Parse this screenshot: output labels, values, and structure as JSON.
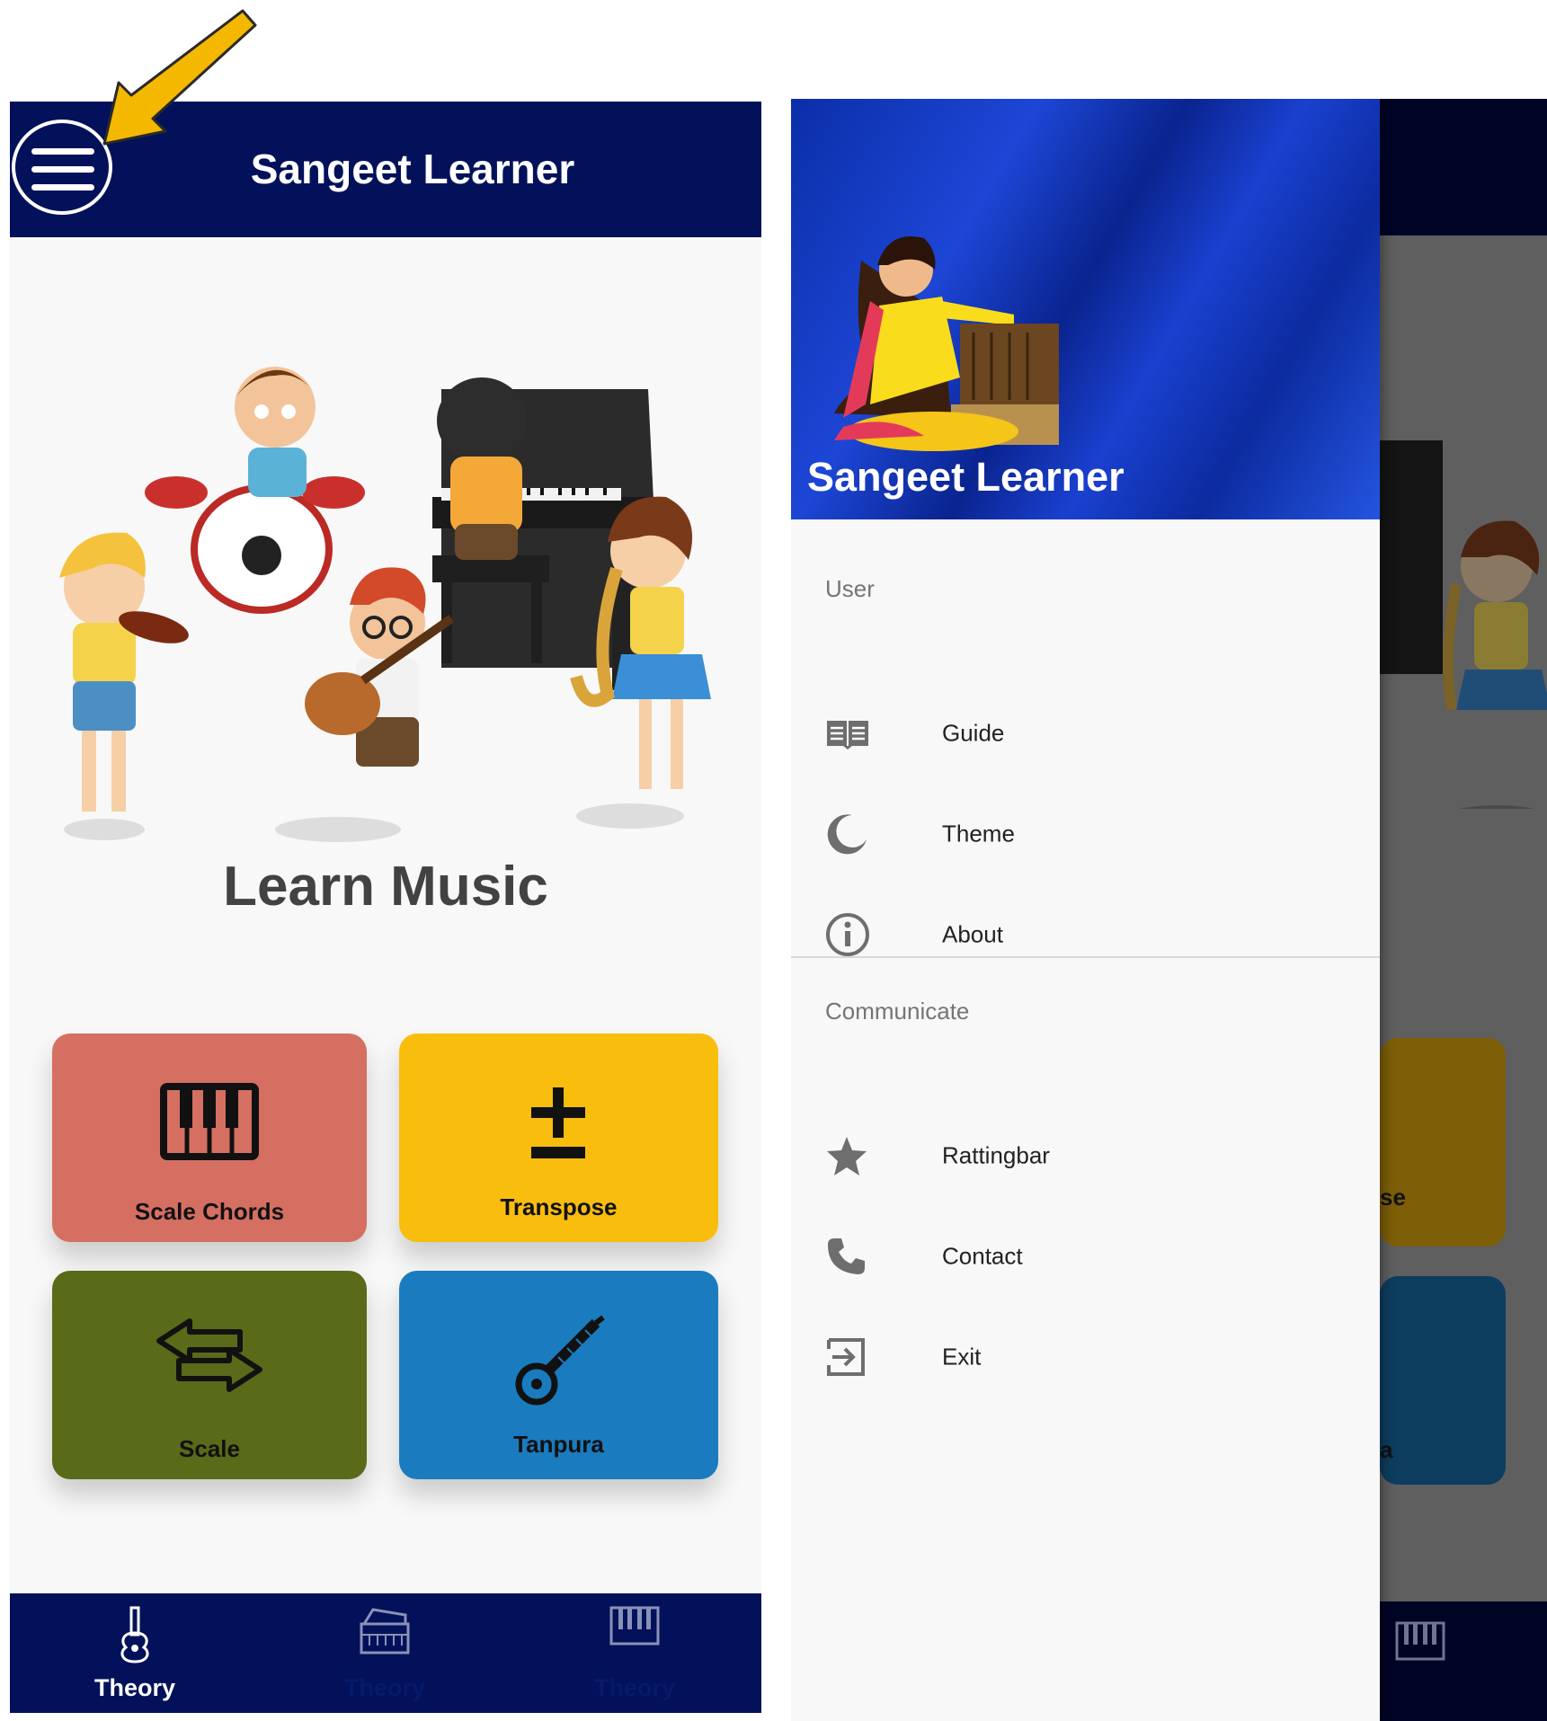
{
  "left": {
    "appbar": {
      "title": "Sangeet Learner",
      "menu_icon": "hamburger-menu-icon"
    },
    "hero": {
      "heading": "Learn Music"
    },
    "tiles": [
      {
        "label": "Scale Chords",
        "icon": "piano-keys-icon",
        "color": "#d56f62"
      },
      {
        "label": "Transpose",
        "icon": "plus-minus-icon",
        "color": "#f9bd0e"
      },
      {
        "label": "Scale",
        "icon": "swap-arrows-icon",
        "color": "#596a19"
      },
      {
        "label": "Tanpura",
        "icon": "sitar-icon",
        "color": "#1a7bbe"
      }
    ],
    "bottom_nav": [
      {
        "label": "Theory",
        "icon": "guitar-icon",
        "active": true
      },
      {
        "label": "Theory",
        "icon": "harmonium-icon",
        "active": false
      },
      {
        "label": "Theory",
        "icon": "piano-keys-icon",
        "active": false
      }
    ],
    "annotation_arrow_color": "#f5b800"
  },
  "drawer": {
    "header_title": "Sangeet Learner",
    "sections": [
      {
        "title": "User",
        "items": [
          {
            "label": "Guide",
            "icon": "book-icon"
          },
          {
            "label": "Theme",
            "icon": "moon-icon"
          },
          {
            "label": "About",
            "icon": "info-icon"
          }
        ]
      },
      {
        "title": "Communicate",
        "items": [
          {
            "label": "Rattingbar",
            "icon": "star-icon"
          },
          {
            "label": "Contact",
            "icon": "phone-icon"
          },
          {
            "label": "Exit",
            "icon": "exit-icon"
          }
        ]
      }
    ],
    "peek_texts": [
      "se",
      "a"
    ]
  },
  "colors": {
    "navy": "#021159",
    "background": "#f8f8f8"
  }
}
